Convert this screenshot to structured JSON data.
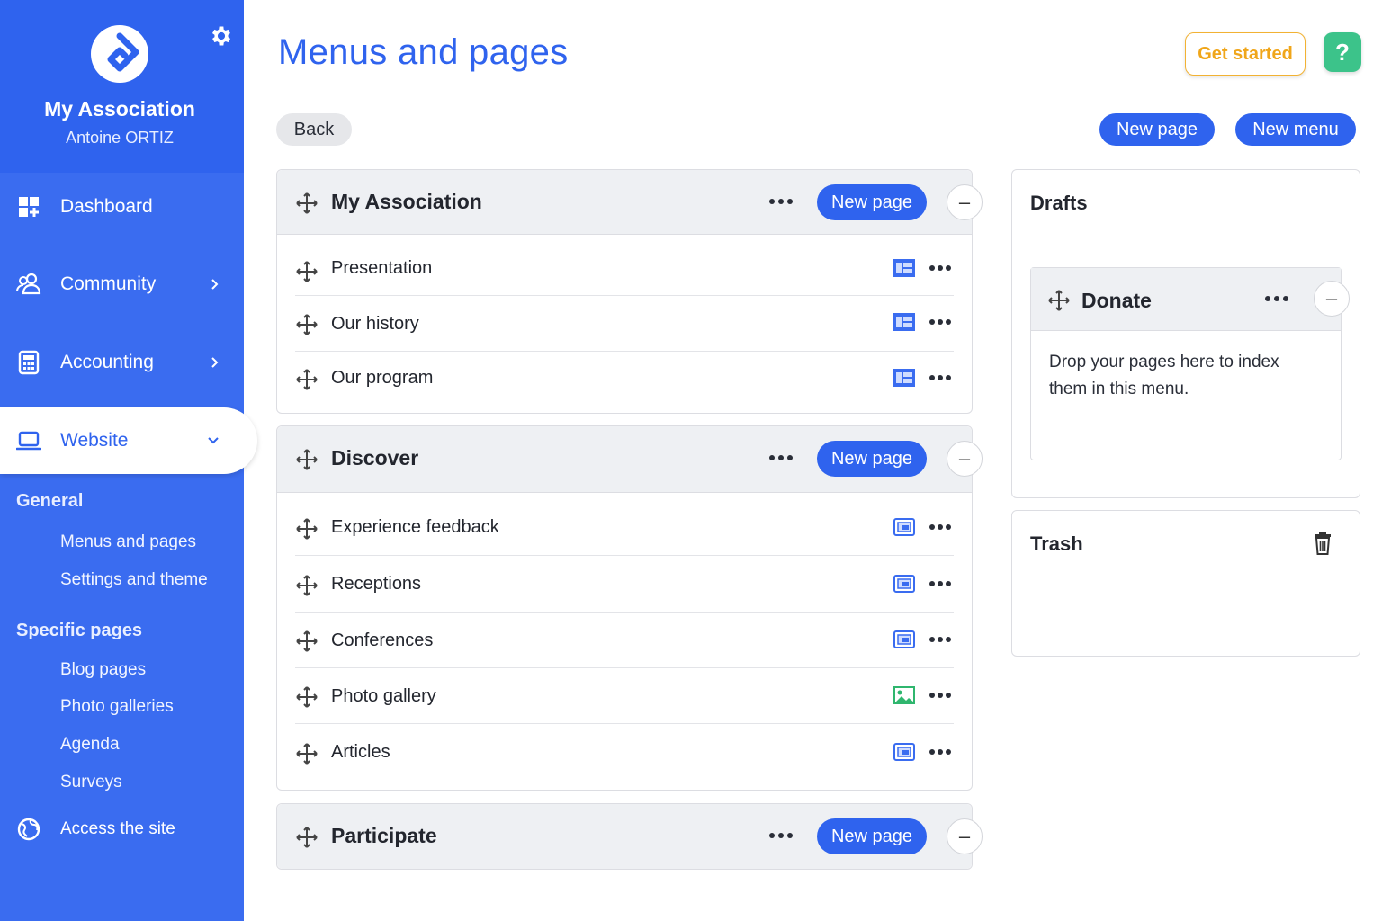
{
  "sidebar": {
    "association_name": "My Association",
    "user_name": "Antoine ORTIZ",
    "nav": {
      "dashboard": "Dashboard",
      "community": "Community",
      "accounting": "Accounting",
      "website": "Website"
    },
    "general_title": "General",
    "general_items": [
      "Menus and pages",
      "Settings and theme"
    ],
    "specific_title": "Specific pages",
    "specific_items": [
      "Blog pages",
      "Photo galleries",
      "Agenda",
      "Surveys"
    ],
    "access_site": "Access the site"
  },
  "header": {
    "title": "Menus and pages",
    "get_started": "Get started",
    "help": "?"
  },
  "toolbar": {
    "back": "Back",
    "new_page": "New page",
    "new_menu": "New menu"
  },
  "menus": [
    {
      "title": "My Association",
      "new_page": "New page",
      "pages": [
        {
          "label": "Presentation",
          "type": "layout-page-icon"
        },
        {
          "label": "Our history",
          "type": "layout-page-icon"
        },
        {
          "label": "Our program",
          "type": "layout-page-icon"
        }
      ]
    },
    {
      "title": "Discover",
      "new_page": "New page",
      "pages": [
        {
          "label": "Experience feedback",
          "type": "blog-page-icon"
        },
        {
          "label": "Receptions",
          "type": "blog-page-icon"
        },
        {
          "label": "Conferences",
          "type": "blog-page-icon"
        },
        {
          "label": "Photo gallery",
          "type": "gallery-page-icon"
        },
        {
          "label": "Articles",
          "type": "blog-page-icon"
        }
      ]
    },
    {
      "title": "Participate",
      "new_page": "New page",
      "pages": []
    }
  ],
  "drafts": {
    "title": "Drafts",
    "menu_title": "Donate",
    "drop_text": "Drop your pages here to index them in this menu."
  },
  "trash": {
    "title": "Trash"
  },
  "colors": {
    "brand_blue": "#2f63ee",
    "sidebar_blue": "#3a6cf0",
    "accent_orange": "#f0a61a",
    "help_green": "#3cc38a",
    "gallery_green": "#2fb66e"
  }
}
